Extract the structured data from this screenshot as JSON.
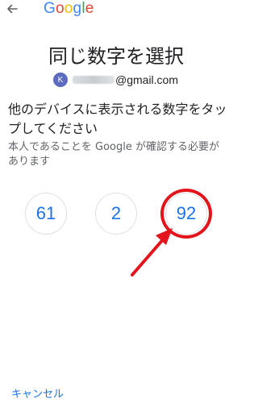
{
  "header": {
    "back_icon": "arrow-left-icon",
    "logo": {
      "letters": [
        "G",
        "o",
        "o",
        "g",
        "l",
        "e"
      ],
      "colors": [
        "#4285F4",
        "#EA4335",
        "#FBBC05",
        "#4285F4",
        "#34A853",
        "#EA4335"
      ]
    }
  },
  "page": {
    "title": "同じ数字を選択"
  },
  "account": {
    "avatar_initial": "K",
    "email_domain": "@gmail.com"
  },
  "instruction": {
    "heading": "他のデバイスに表示される数字をタップしてください",
    "subtext": "本人であることを Google が確認する必要があります"
  },
  "numbers": [
    "61",
    "2",
    "92"
  ],
  "annotation": {
    "highlight_color": "#e3141b",
    "highlighted_number": "92"
  },
  "footer": {
    "cancel_label": "キャンセル"
  },
  "colors": {
    "accent": "#1a73e8",
    "text_primary": "#202124",
    "text_secondary": "#5f6368"
  }
}
